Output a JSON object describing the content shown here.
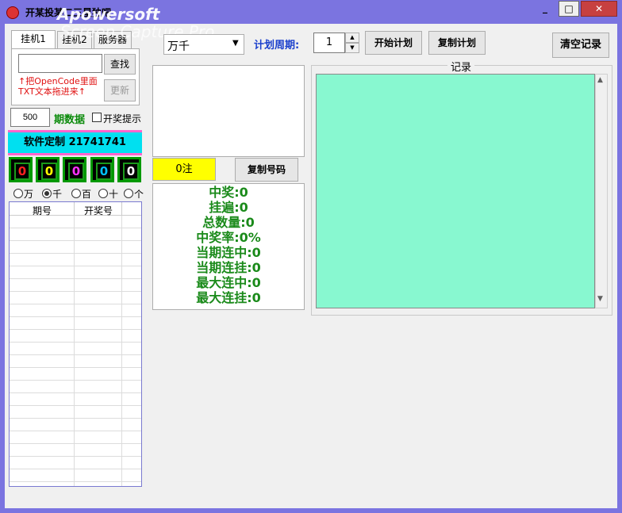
{
  "window": {
    "title": "开某投某二三星独吧",
    "watermark_line1": "Apowersoft",
    "watermark_line2": "Screen Capture Pro",
    "minimize": "_",
    "maximize": "□",
    "close": "✕"
  },
  "tabs": [
    "挂机1",
    "挂机2",
    "服务器"
  ],
  "search": {
    "value": "",
    "button": "查找",
    "update_button": "更新"
  },
  "hint_line1": "↑把OpenCode里面",
  "hint_line2": "TXT文本拖进来↑",
  "period_count": {
    "value": "500",
    "label": "期数据"
  },
  "prize_tip": {
    "label": "开奖提示",
    "checked": false
  },
  "custom_banner": "软件定制 21741741",
  "digits": [
    {
      "value": "0",
      "color": "#ff2020"
    },
    {
      "value": "0",
      "color": "#ffff00"
    },
    {
      "value": "0",
      "color": "#ff30ff"
    },
    {
      "value": "0",
      "color": "#00c0ff"
    },
    {
      "value": "0",
      "color": "#ffffff"
    }
  ],
  "positions": [
    {
      "label": "万",
      "selected": false
    },
    {
      "label": "千",
      "selected": true
    },
    {
      "label": "百",
      "selected": false
    },
    {
      "label": "十",
      "selected": false
    },
    {
      "label": "个",
      "selected": false
    }
  ],
  "history_table": {
    "columns": [
      "期号",
      "开奖号"
    ]
  },
  "plan_select": {
    "value": "万千"
  },
  "plan_cycle": {
    "label": "计划周期:",
    "value": "1"
  },
  "buttons": {
    "start_plan": "开始计划",
    "copy_plan": "复制计划",
    "clear_records": "清空记录",
    "copy_numbers": "复制号码"
  },
  "bet_count": "0注",
  "stats": [
    {
      "label": "中奖:",
      "value": "0"
    },
    {
      "label": "挂遍:",
      "value": "0"
    },
    {
      "label": "总数量:",
      "value": "0"
    },
    {
      "label": "中奖率:",
      "value": "0%"
    },
    {
      "label": "当期连中:",
      "value": "0"
    },
    {
      "label": "当期连挂:",
      "value": "0"
    },
    {
      "label": "最大连中:",
      "value": "0"
    },
    {
      "label": "最大连挂:",
      "value": "0"
    }
  ],
  "records_group": {
    "label": "记录"
  },
  "colors": {
    "frame": "#7b74e0",
    "records_bg": "#88f8d0",
    "stats_text": "#1a8a1a",
    "cycle_label": "#1a3fcc",
    "bet_bg": "#ffff00"
  }
}
